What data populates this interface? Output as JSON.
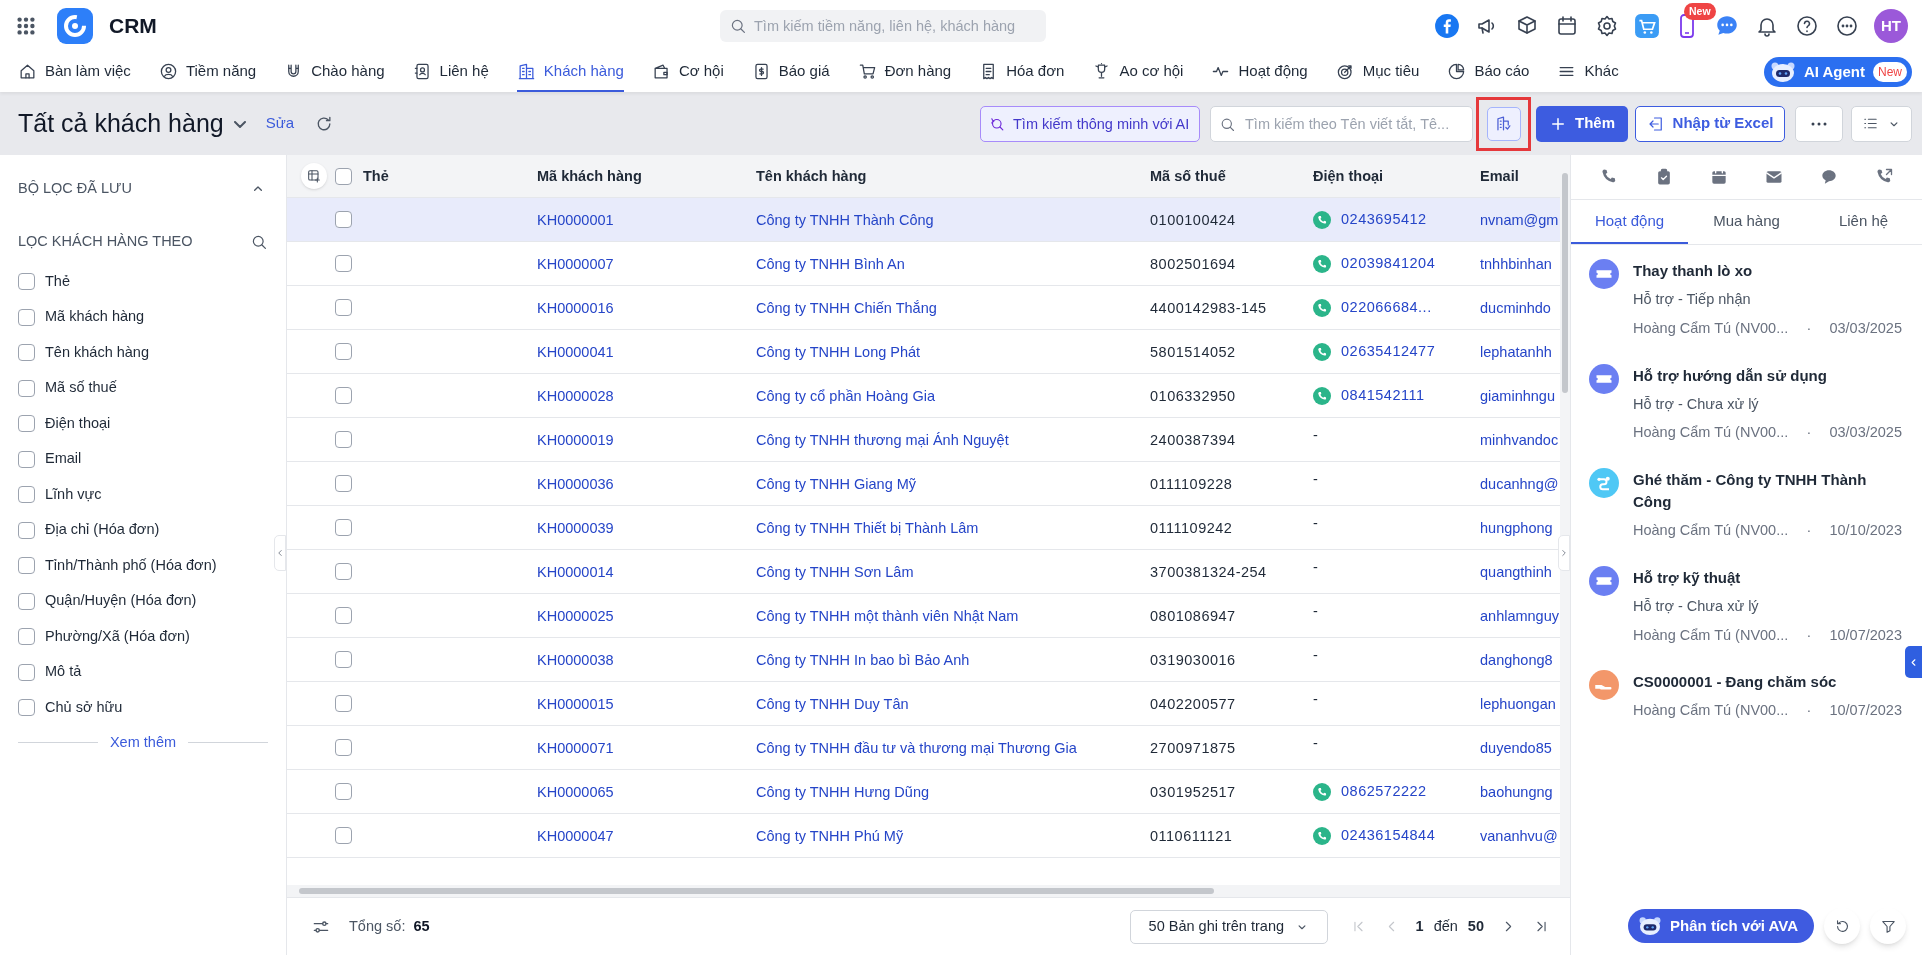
{
  "app": {
    "name": "CRM"
  },
  "global_search": {
    "placeholder": "Tìm kiếm tiềm năng, liên hệ, khách hàng"
  },
  "header": {
    "new_badge": "New",
    "avatar_initials": "HT"
  },
  "nav": [
    {
      "label": "Bàn làm việc",
      "selected": false
    },
    {
      "label": "Tiềm năng",
      "selected": false
    },
    {
      "label": "Chào hàng",
      "selected": false
    },
    {
      "label": "Liên hệ",
      "selected": false
    },
    {
      "label": "Khách hàng",
      "selected": true
    },
    {
      "label": "Cơ hội",
      "selected": false
    },
    {
      "label": "Báo giá",
      "selected": false
    },
    {
      "label": "Đơn hàng",
      "selected": false
    },
    {
      "label": "Hóa đơn",
      "selected": false
    },
    {
      "label": "Ao cơ hội",
      "selected": false
    },
    {
      "label": "Hoạt động",
      "selected": false
    },
    {
      "label": "Mục tiêu",
      "selected": false
    },
    {
      "label": "Báo cáo",
      "selected": false
    },
    {
      "label": "Khác",
      "selected": false
    }
  ],
  "ai_agent": {
    "label": "AI Agent",
    "badge": "New"
  },
  "toolbar": {
    "title": "Tất cả khách hàng",
    "edit_link": "Sửa",
    "ai_search": {
      "placeholder": "Tìm kiếm thông minh với AI"
    },
    "search": {
      "placeholder": "Tìm kiếm theo Tên viết tắt, Tê..."
    },
    "add_button": "Thêm",
    "import_button": "Nhập từ Excel"
  },
  "sidebar": {
    "saved_filters": {
      "title": "BỘ LỌC ĐÃ LƯU",
      "expanded": true
    },
    "filter_by": {
      "title": "LỌC KHÁCH HÀNG THEO"
    },
    "fields": [
      {
        "label": "Thẻ",
        "checked": false
      },
      {
        "label": "Mã khách hàng",
        "checked": false
      },
      {
        "label": "Tên khách hàng",
        "checked": false
      },
      {
        "label": "Mã số thuế",
        "checked": false
      },
      {
        "label": "Điện thoại",
        "checked": false
      },
      {
        "label": "Email",
        "checked": false
      },
      {
        "label": "Lĩnh vực",
        "checked": false
      },
      {
        "label": "Địa chỉ (Hóa đơn)",
        "checked": false
      },
      {
        "label": "Tỉnh/Thành phố (Hóa đơn)",
        "checked": false
      },
      {
        "label": "Quận/Huyện (Hóa đơn)",
        "checked": false
      },
      {
        "label": "Phường/Xã (Hóa đơn)",
        "checked": false
      },
      {
        "label": "Mô tả",
        "checked": false
      },
      {
        "label": "Chủ sở hữu",
        "checked": false
      }
    ],
    "more_link": "Xem thêm"
  },
  "table": {
    "select_all_checked": false,
    "columns": [
      "Thẻ",
      "Mã khách hàng",
      "Tên khách hàng",
      "Mã số thuế",
      "Điện thoại",
      "Email"
    ],
    "rows": [
      {
        "selected": true,
        "checked": false,
        "code": "KH0000001",
        "name": "Công ty TNHH Thành Công",
        "tax_code": "0100100424",
        "phone": {
          "text": "0243695412",
          "call_icon": true
        },
        "email": "nvnam@gm"
      },
      {
        "selected": false,
        "checked": false,
        "code": "KH0000007",
        "name": "Công ty TNHH Bình An",
        "tax_code": "8002501694",
        "phone": {
          "text": "02039841204",
          "call_icon": true
        },
        "email": "tnhhbinhan"
      },
      {
        "selected": false,
        "checked": false,
        "code": "KH0000016",
        "name": "Công ty TNHH Chiến Thắng",
        "tax_code": "4400142983-145",
        "phone": {
          "text": "022066684...",
          "call_icon": true
        },
        "email": "ducminhdo"
      },
      {
        "selected": false,
        "checked": false,
        "code": "KH0000041",
        "name": "Công ty TNHH Long Phát",
        "tax_code": "5801514052",
        "phone": {
          "text": "02635412477",
          "call_icon": true
        },
        "email": "lephatanhh"
      },
      {
        "selected": false,
        "checked": false,
        "code": "KH0000028",
        "name": "Công ty cổ phần Hoàng Gia",
        "tax_code": "0106332950",
        "phone": {
          "text": "0841542111",
          "call_icon": true
        },
        "email": "giaminhngu"
      },
      {
        "selected": false,
        "checked": false,
        "code": "KH0000019",
        "name": "Công ty TNHH thương mại Ánh Nguyệt",
        "tax_code": "2400387394",
        "phone": {
          "text": "-",
          "call_icon": false
        },
        "email": "minhvandoc"
      },
      {
        "selected": false,
        "checked": false,
        "code": "KH0000036",
        "name": "Công ty TNHH Giang Mỹ",
        "tax_code": "0111109228",
        "phone": {
          "text": "-",
          "call_icon": false
        },
        "email": "ducanhng@"
      },
      {
        "selected": false,
        "checked": false,
        "code": "KH0000039",
        "name": "Công ty TNHH Thiết bị Thành Lâm",
        "tax_code": "0111109242",
        "phone": {
          "text": "-",
          "call_icon": false
        },
        "email": "hungphong"
      },
      {
        "selected": false,
        "checked": false,
        "code": "KH0000014",
        "name": "Công ty TNHH Sơn Lâm",
        "tax_code": "3700381324-254",
        "phone": {
          "text": "-",
          "call_icon": false
        },
        "email": "quangthinh"
      },
      {
        "selected": false,
        "checked": false,
        "code": "KH0000025",
        "name": "Công ty TNHH một thành viên Nhật Nam",
        "tax_code": "0801086947",
        "phone": {
          "text": "-",
          "call_icon": false
        },
        "email": "anhlamnguy"
      },
      {
        "selected": false,
        "checked": false,
        "code": "KH0000038",
        "name": "Công ty TNHH In bao bì Bảo Anh",
        "tax_code": "0319030016",
        "phone": {
          "text": "-",
          "call_icon": false
        },
        "email": "danghong8"
      },
      {
        "selected": false,
        "checked": false,
        "code": "KH0000015",
        "name": "Công ty TNHH Duy Tân",
        "tax_code": "0402200577",
        "phone": {
          "text": "-",
          "call_icon": false
        },
        "email": "lephuongan"
      },
      {
        "selected": false,
        "checked": false,
        "code": "KH0000071",
        "name": "Công ty TNHH đầu tư và thương mại Thương Gia",
        "tax_code": "2700971875",
        "phone": {
          "text": "-",
          "call_icon": false
        },
        "email": "duyendo85"
      },
      {
        "selected": false,
        "checked": false,
        "code": "KH0000065",
        "name": "Công ty TNHH Hưng Dũng",
        "tax_code": "0301952517",
        "phone": {
          "text": "0862572222",
          "call_icon": true
        },
        "email": "baohungng"
      },
      {
        "selected": false,
        "checked": false,
        "code": "KH0000047",
        "name": "Công ty TNHH Phú Mỹ",
        "tax_code": "0110611121",
        "phone": {
          "text": "02436154844",
          "call_icon": true
        },
        "email": "vananhvu@"
      }
    ]
  },
  "footer": {
    "total_label": "Tổng số:",
    "total": "65",
    "page_size": "50 Bản ghi trên trang",
    "page_from": "1",
    "page_separator": "đến",
    "page_to": "50"
  },
  "right_panel": {
    "tabs": [
      {
        "label": "Hoạt động",
        "selected": true
      },
      {
        "label": "Mua hàng",
        "selected": false
      },
      {
        "label": "Liên hệ",
        "selected": false
      }
    ],
    "activities": [
      {
        "kind": "ticket",
        "color": "#6b7ff2",
        "title": "Thay thanh lò xo",
        "subtitle": "Hỗ trợ - Tiếp nhận",
        "owner": "Hoàng Cẩm Tú (NV00...",
        "separator": "·",
        "date": "03/03/2025"
      },
      {
        "kind": "ticket",
        "color": "#6b7ff2",
        "title": "Hỗ trợ hướng dẫn sử dụng",
        "subtitle": "Hỗ trợ - Chưa xử lý",
        "owner": "Hoàng Cẩm Tú (NV00...",
        "separator": "·",
        "date": "03/03/2025"
      },
      {
        "kind": "visit",
        "color": "#4fc8f5",
        "title": "Ghé thăm - Công ty TNHH Thành Công",
        "owner": "Hoàng Cẩm Tú (NV00...",
        "separator": "·",
        "date": "10/10/2023"
      },
      {
        "kind": "ticket",
        "color": "#6b7ff2",
        "title": "Hỗ trợ kỹ thuật",
        "subtitle": "Hỗ trợ - Chưa xử lý",
        "owner": "Hoàng Cẩm Tú (NV00...",
        "separator": "·",
        "date": "10/07/2023"
      },
      {
        "kind": "care",
        "color": "#f3976a",
        "title": "CS0000001 - Đang chăm sóc",
        "owner": "Hoàng Cẩm Tú (NV00...",
        "separator": "·",
        "date": "10/07/2023"
      }
    ],
    "ava_button": "Phân tích với AVA"
  }
}
